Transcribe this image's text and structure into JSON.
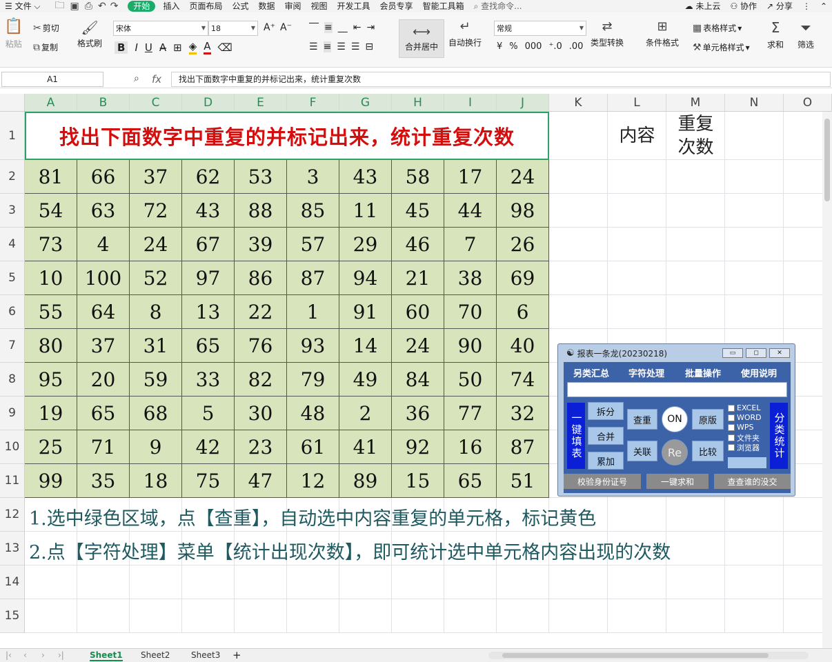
{
  "menubar": {
    "items": [
      "文件",
      "开始",
      "插入",
      "页面布局",
      "公式",
      "数据",
      "审阅",
      "视图",
      "开发工具",
      "会员专享",
      "智能工具箱"
    ],
    "search_placeholder": "查找命令...",
    "right": [
      "未上云",
      "协作",
      "分享"
    ]
  },
  "ribbon": {
    "paste": "粘贴",
    "cut": "剪切",
    "copy": "复制",
    "format_painter": "格式刷",
    "font_name": "宋体",
    "font_size": "18",
    "merge": "合并居中",
    "wrap": "自动换行",
    "number_format": "常规",
    "type_convert": "类型转换",
    "cond_format": "条件格式",
    "table_style": "表格样式",
    "cell_style": "单元格样式",
    "sum": "求和",
    "filter": "筛选"
  },
  "formula": {
    "cell_ref": "A1",
    "fx": "fx",
    "content": "找出下面数字中重复的并标记出来，统计重复次数"
  },
  "columns": [
    "A",
    "B",
    "C",
    "D",
    "E",
    "F",
    "G",
    "H",
    "I",
    "J",
    "K",
    "L",
    "M",
    "N",
    "O"
  ],
  "rows": [
    "1",
    "2",
    "3",
    "4",
    "5",
    "6",
    "7",
    "8",
    "9",
    "10",
    "11",
    "12",
    "13",
    "14",
    "15"
  ],
  "sheet": {
    "title": "找出下面数字中重复的并标记出来，统计重复次数",
    "l1": "内容",
    "m1": "重复\n次数",
    "data": [
      [
        "81",
        "66",
        "37",
        "62",
        "53",
        "3",
        "43",
        "58",
        "17",
        "24"
      ],
      [
        "54",
        "63",
        "72",
        "43",
        "88",
        "85",
        "11",
        "45",
        "44",
        "98"
      ],
      [
        "73",
        "4",
        "24",
        "67",
        "39",
        "57",
        "29",
        "46",
        "7",
        "26"
      ],
      [
        "10",
        "100",
        "52",
        "97",
        "86",
        "87",
        "94",
        "21",
        "38",
        "69"
      ],
      [
        "55",
        "64",
        "8",
        "13",
        "22",
        "1",
        "91",
        "60",
        "70",
        "6"
      ],
      [
        "80",
        "37",
        "31",
        "65",
        "76",
        "93",
        "14",
        "24",
        "90",
        "40"
      ],
      [
        "95",
        "20",
        "59",
        "33",
        "82",
        "79",
        "49",
        "84",
        "50",
        "74"
      ],
      [
        "19",
        "65",
        "68",
        "5",
        "30",
        "48",
        "2",
        "36",
        "77",
        "32"
      ],
      [
        "25",
        "71",
        "9",
        "42",
        "23",
        "61",
        "41",
        "92",
        "16",
        "87"
      ],
      [
        "99",
        "35",
        "18",
        "75",
        "47",
        "12",
        "89",
        "15",
        "65",
        "51"
      ]
    ],
    "note1": "1.选中绿色区域，点【查重】，自动选中内容重复的单元格，标记黄色",
    "note2": "2.点【字符处理】菜单【统计出现次数】，即可统计选中单元格内容出现的次数"
  },
  "plugin": {
    "title": "报表一条龙(20230218)",
    "menus": [
      "另类汇总",
      "字符处理",
      "批量操作",
      "使用说明"
    ],
    "left_vertical": "一键填表",
    "right_vertical": "分类统计",
    "buttons": [
      "拆分",
      "合并",
      "累加",
      "查重",
      "关联",
      "ON",
      "Re",
      "原版",
      "比较"
    ],
    "checks": [
      "EXCEL",
      "WORD",
      "WPS",
      "文件夹",
      "浏览器"
    ],
    "bottom": [
      "校验身份证号",
      "一键求和",
      "查查谁的没交"
    ]
  },
  "sheets": [
    "Sheet1",
    "Sheet2",
    "Sheet3"
  ],
  "colors": {
    "accent": "#1aad6a",
    "data_fill": "#d8e4bc",
    "title_red": "#d40d0d",
    "note_teal": "#1e5a60"
  }
}
